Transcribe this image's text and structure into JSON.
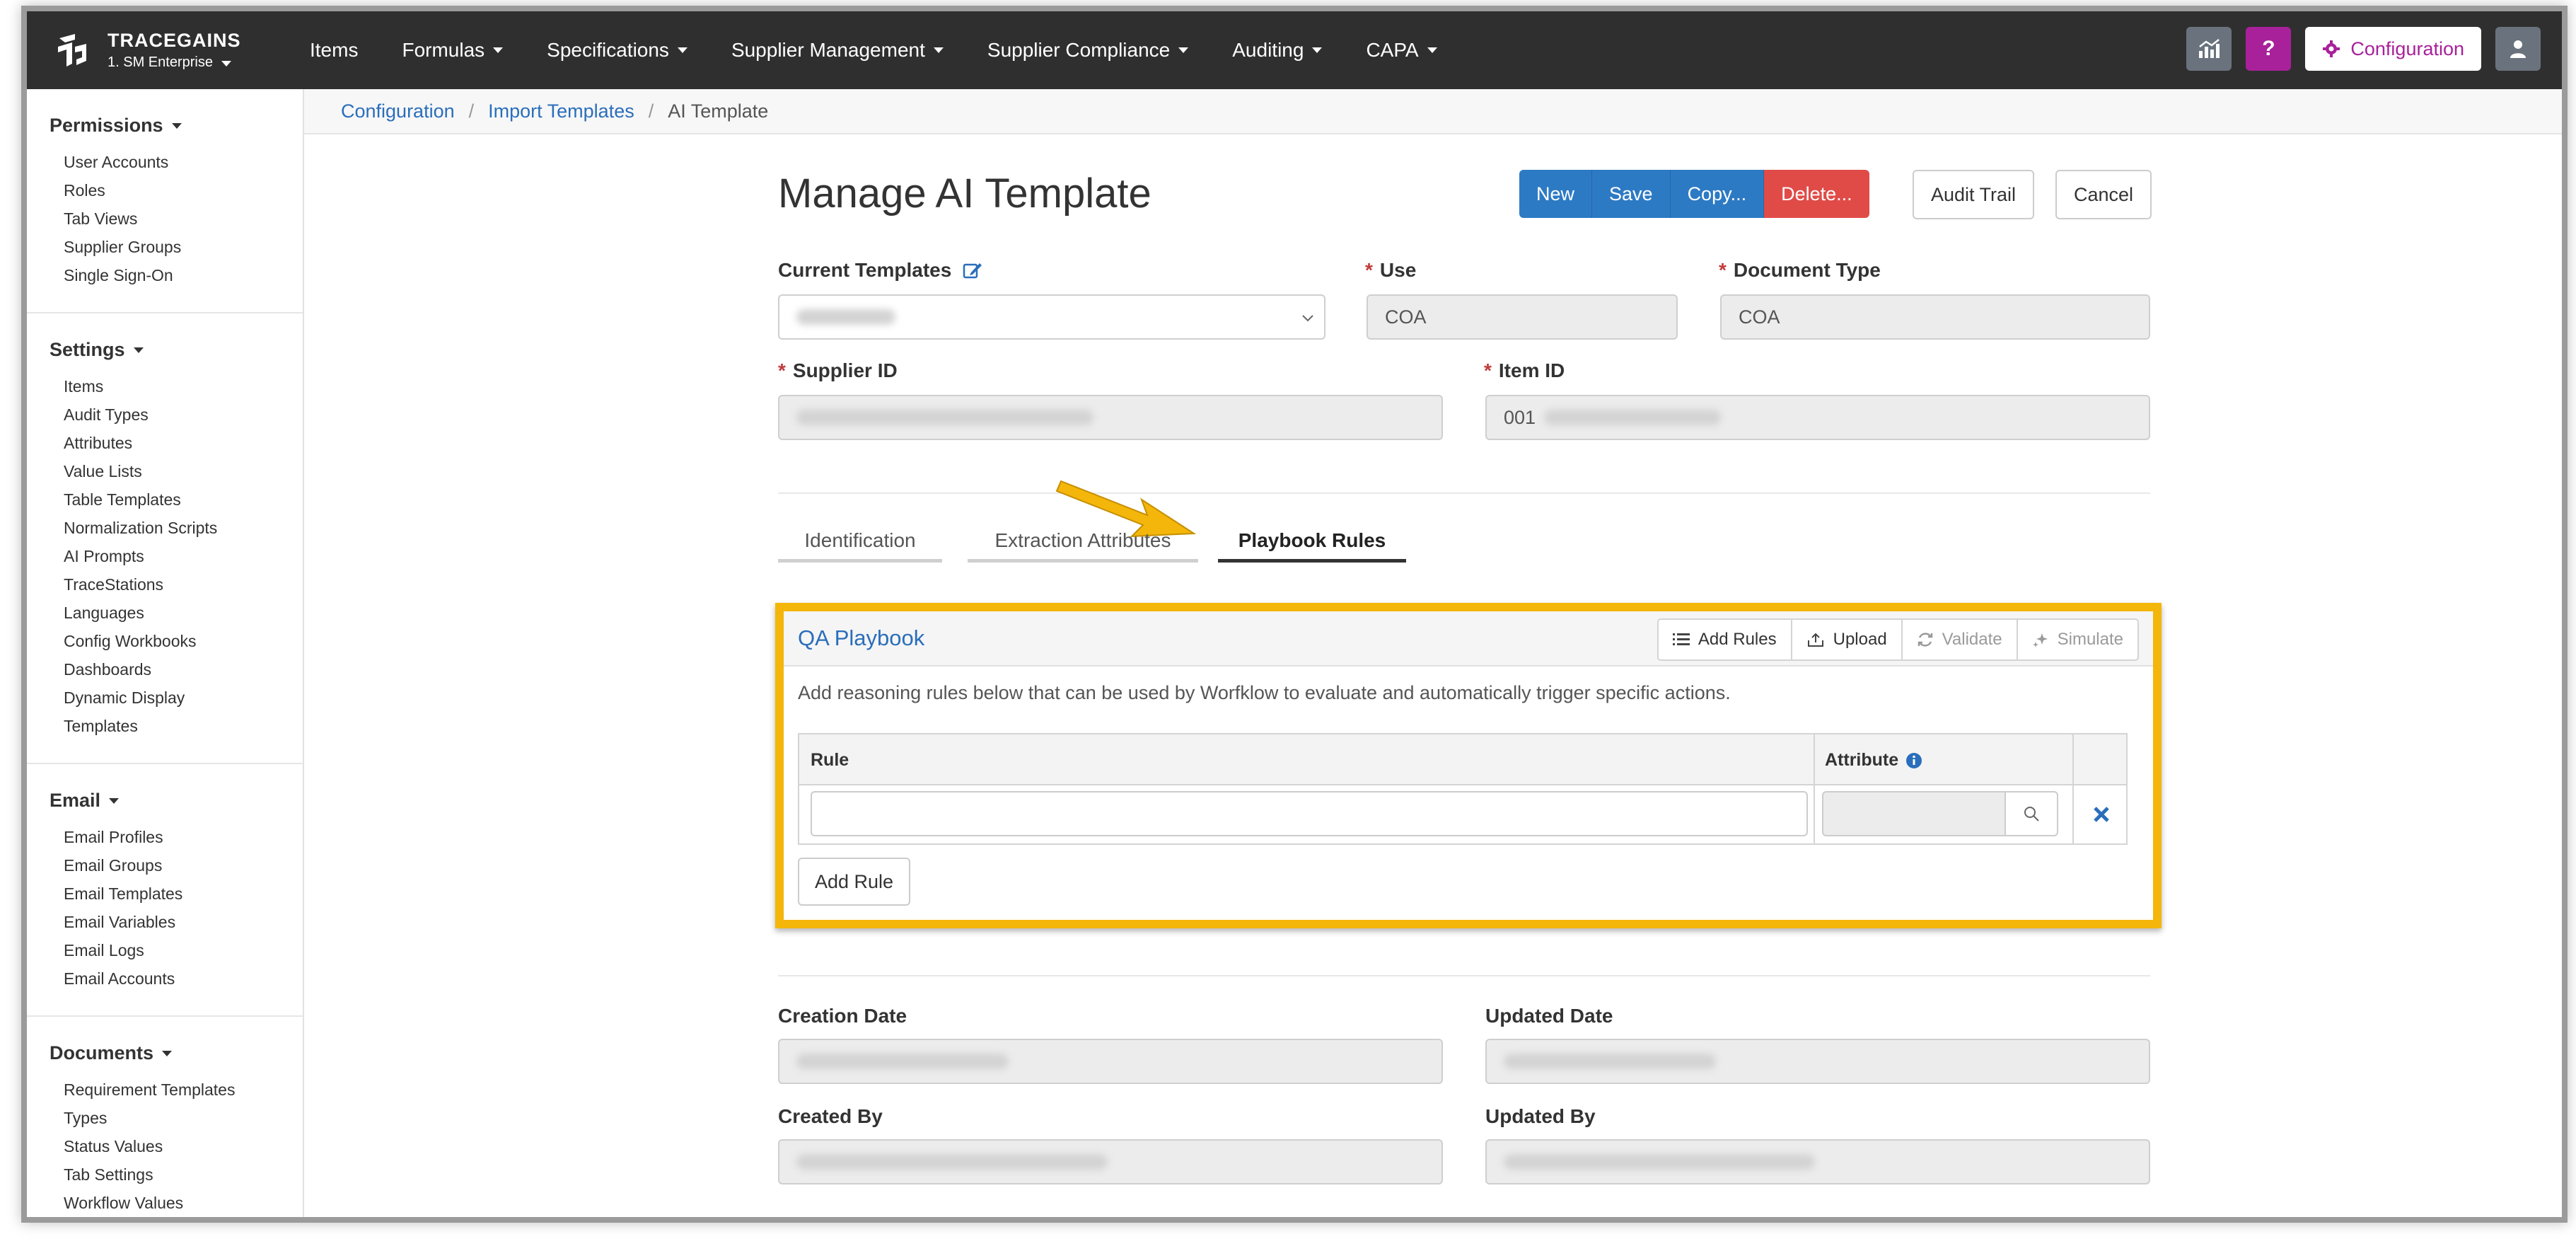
{
  "brand": {
    "name": "TRACEGAINS",
    "account": "1. SM Enterprise"
  },
  "nav": {
    "items": [
      {
        "label": "Items",
        "dropdown": false
      },
      {
        "label": "Formulas",
        "dropdown": true
      },
      {
        "label": "Specifications",
        "dropdown": true
      },
      {
        "label": "Supplier Management",
        "dropdown": true
      },
      {
        "label": "Supplier Compliance",
        "dropdown": true
      },
      {
        "label": "Auditing",
        "dropdown": true
      },
      {
        "label": "CAPA",
        "dropdown": true
      }
    ],
    "help_label": "?",
    "config_label": "Configuration"
  },
  "sidebar": {
    "permissions": {
      "title": "Permissions",
      "items": [
        "User Accounts",
        "Roles",
        "Tab Views",
        "Supplier Groups",
        "Single Sign-On"
      ]
    },
    "settings": {
      "title": "Settings",
      "items": [
        "Items",
        "Audit Types",
        "Attributes",
        "Value Lists",
        "Table Templates",
        "Normalization Scripts",
        "AI Prompts",
        "TraceStations",
        "Languages",
        "Config Workbooks",
        "Dashboards",
        "Dynamic Display",
        "Templates"
      ]
    },
    "email": {
      "title": "Email",
      "items": [
        "Email Profiles",
        "Email Groups",
        "Email Templates",
        "Email Variables",
        "Email Logs",
        "Email Accounts"
      ]
    },
    "documents": {
      "title": "Documents",
      "items": [
        "Requirement Templates",
        "Types",
        "Status Values",
        "Tab Settings",
        "Workflow Values"
      ]
    }
  },
  "breadcrumb": {
    "first": "Configuration",
    "second": "Import Templates",
    "current": "AI Template"
  },
  "page": {
    "title": "Manage AI Template",
    "buttons": {
      "new": "New",
      "save": "Save",
      "copy": "Copy...",
      "delete": "Delete...",
      "audit_trail": "Audit Trail",
      "cancel": "Cancel"
    }
  },
  "form": {
    "current_templates_label": "Current Templates",
    "use_label": "Use",
    "use_value": "COA",
    "document_type_label": "Document Type",
    "document_type_value": "COA",
    "supplier_id_label": "Supplier ID",
    "item_id_label": "Item ID",
    "item_id_value": "001"
  },
  "tabs": [
    {
      "label": "Identification",
      "active": false
    },
    {
      "label": "Extraction Attributes",
      "active": false
    },
    {
      "label": "Playbook Rules",
      "active": true
    }
  ],
  "playbook": {
    "title": "QA Playbook",
    "toolbar": {
      "add_rules": "Add Rules",
      "upload": "Upload",
      "validate": "Validate",
      "simulate": "Simulate"
    },
    "description": "Add reasoning rules below that can be used by Worfklow to evaluate and automatically trigger specific actions.",
    "rule_header": "Rule",
    "attribute_header": "Attribute",
    "add_rule_label": "Add Rule"
  },
  "audit": {
    "creation_date_label": "Creation Date",
    "updated_date_label": "Updated Date",
    "created_by_label": "Created By",
    "updated_by_label": "Updated By"
  },
  "colors": {
    "highlight": "#f4b60a",
    "primary": "#2d7ac4",
    "danger": "#e04b48",
    "accent": "#a8219a",
    "link": "#2a6ebb"
  }
}
